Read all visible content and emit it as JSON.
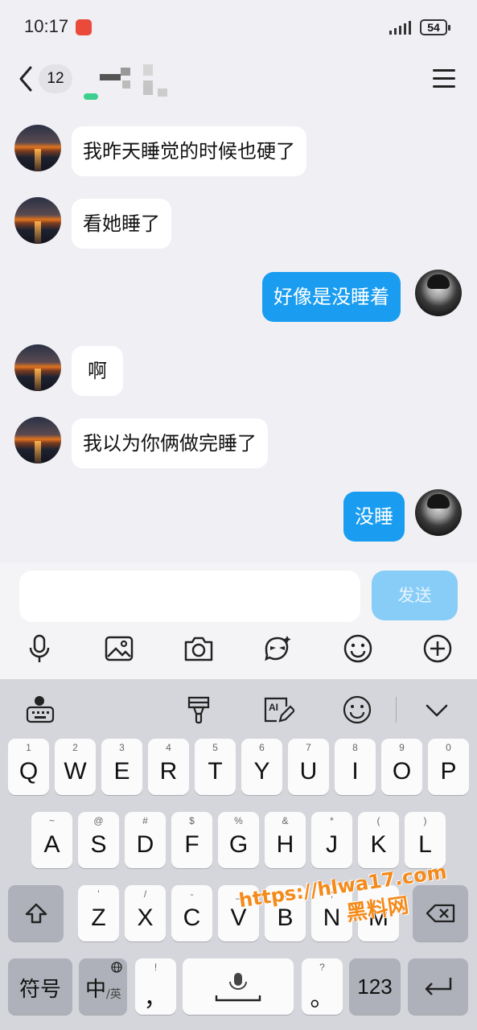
{
  "status_bar": {
    "time": "10:17",
    "battery": "54"
  },
  "nav": {
    "unread_count": "12"
  },
  "messages": [
    {
      "side": "in",
      "text": "我昨天睡觉的时候也硬了"
    },
    {
      "side": "in",
      "text": "看她睡了"
    },
    {
      "side": "out",
      "text": "好像是没睡着"
    },
    {
      "side": "in",
      "text": "啊"
    },
    {
      "side": "in",
      "text": "我以为你俩做完睡了"
    },
    {
      "side": "out",
      "text": "没睡"
    }
  ],
  "composer": {
    "input_value": "",
    "send_label": "发送"
  },
  "toolbar_icons": [
    "microphone-icon",
    "image-icon",
    "camera-icon",
    "sticker-icon",
    "emoji-icon",
    "plus-icon"
  ],
  "keyboard": {
    "row1": [
      {
        "sub": "1",
        "key": "Q"
      },
      {
        "sub": "2",
        "key": "W"
      },
      {
        "sub": "3",
        "key": "E"
      },
      {
        "sub": "4",
        "key": "R"
      },
      {
        "sub": "5",
        "key": "T"
      },
      {
        "sub": "6",
        "key": "Y"
      },
      {
        "sub": "7",
        "key": "U"
      },
      {
        "sub": "8",
        "key": "I"
      },
      {
        "sub": "9",
        "key": "O"
      },
      {
        "sub": "0",
        "key": "P"
      }
    ],
    "row2": [
      {
        "sub": "~",
        "key": "A"
      },
      {
        "sub": "@",
        "key": "S"
      },
      {
        "sub": "#",
        "key": "D"
      },
      {
        "sub": "$",
        "key": "F"
      },
      {
        "sub": "%",
        "key": "G"
      },
      {
        "sub": "&",
        "key": "H"
      },
      {
        "sub": "*",
        "key": "J"
      },
      {
        "sub": "(",
        "key": "K"
      },
      {
        "sub": ")",
        "key": "L"
      }
    ],
    "row3": [
      {
        "sub": "'",
        "key": "Z"
      },
      {
        "sub": "/",
        "key": "X"
      },
      {
        "sub": "-",
        "key": "C"
      },
      {
        "sub": "_",
        "key": "V"
      },
      {
        "sub": ":",
        "key": "B"
      },
      {
        "sub": ";",
        "key": "N"
      },
      {
        "sub": "",
        "key": "M"
      }
    ],
    "symbols_label": "符号",
    "lang_main": "中",
    "lang_sub": "/英",
    "comma_sub": "!",
    "comma_main": "，",
    "period_sub": "?",
    "period_main": "。",
    "numbers_label": "123"
  },
  "watermark": {
    "url": "https://hlwa17.com",
    "brand": "黑料网"
  }
}
